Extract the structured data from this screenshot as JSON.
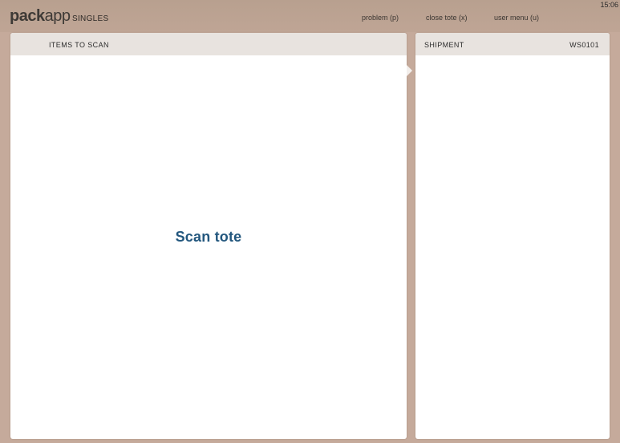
{
  "app": {
    "logo_bold": "pack",
    "logo_light": "app",
    "mode": "SINGLES"
  },
  "nav": {
    "problem": "problem (p)",
    "close_tote": "close tote (x)",
    "user_menu": "user menu (u)"
  },
  "status_bar": {
    "time": "15:06"
  },
  "items_panel": {
    "title": "ITEMS TO SCAN",
    "prompt": "Scan tote"
  },
  "shipment_panel": {
    "title": "SHIPMENT",
    "station": "WS0101"
  },
  "colors": {
    "background": "#c5aa9b",
    "header_bg": "#e8e3df",
    "prompt_text": "#23577e"
  }
}
